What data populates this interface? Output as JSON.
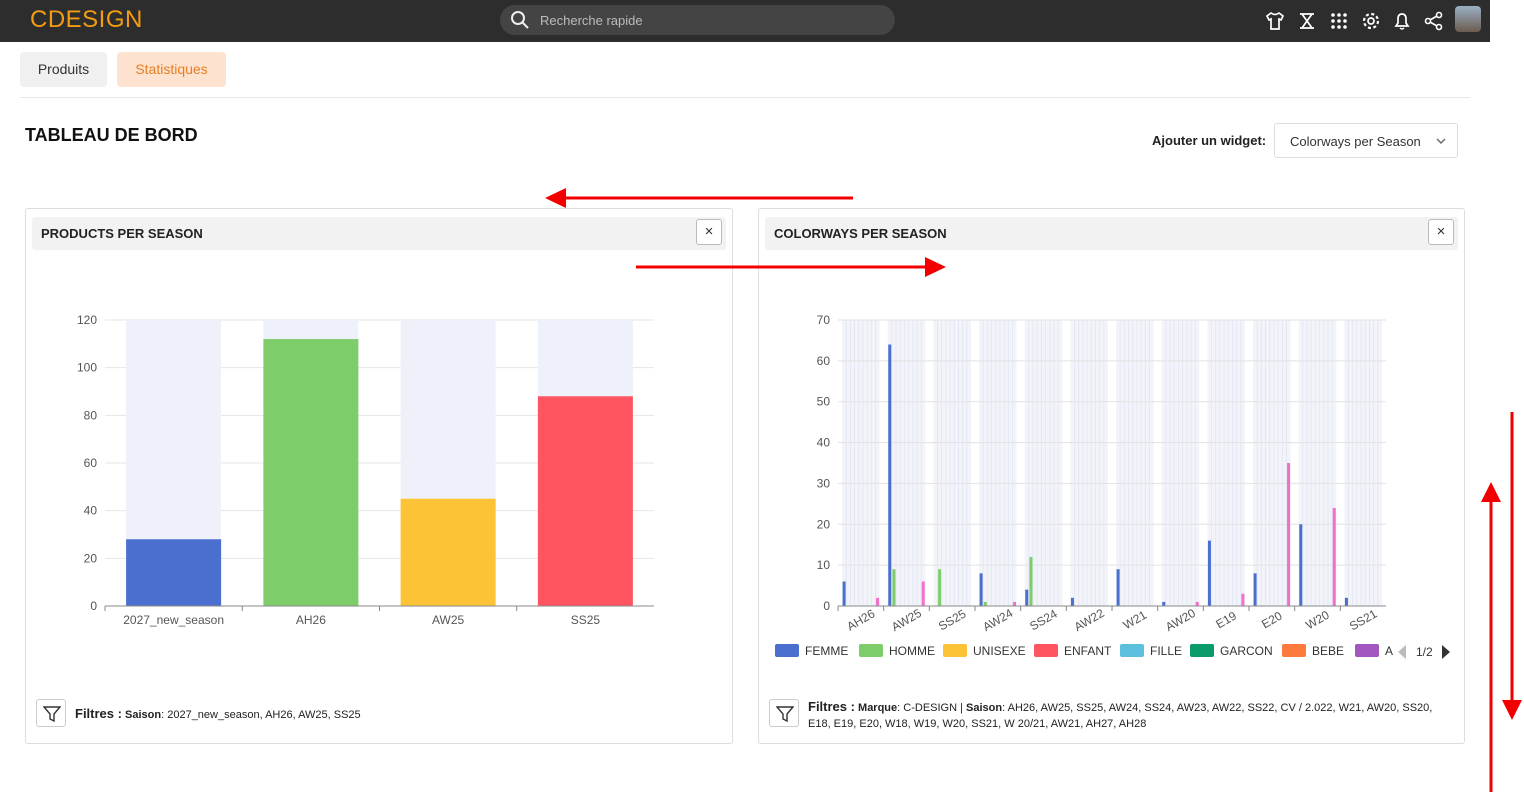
{
  "app": {
    "logo_text": "CDESIGN",
    "search_placeholder": "Recherche rapide",
    "toolbar_icons": [
      "tshirt-icon",
      "collection-icon",
      "apps-grid-icon",
      "gear-icon",
      "bell-icon",
      "share-icon",
      "avatar"
    ]
  },
  "tabs": [
    {
      "label": "Produits",
      "active": false
    },
    {
      "label": "Statistiques",
      "active": true
    }
  ],
  "page": {
    "title": "TABLEAU DE BORD",
    "widget_label": "Ajouter un widget:",
    "widget_select_value": "Colorways per Season"
  },
  "widgets": {
    "products": {
      "title": "PRODUCTS PER SEASON",
      "close_label": "×",
      "filters_lead": "Filtres :",
      "filters_key": "Saison",
      "filters_value": ": 2027_new_season, AH26, AW25, SS25"
    },
    "colorways": {
      "title": "COLORWAYS PER SEASON",
      "close_label": "×",
      "filters_lead": "Filtres :",
      "filters_key1": "Marque",
      "filters_value1": ": C-DESIGN | ",
      "filters_key2": "Saison",
      "filters_value2": ": AH26, AW25, SS25, AW24, SS24, AW23, AW22, SS22, CV / 2.022, W21, AW20, SS20, E18, E19, E20, W18, W19, W20, SS21, W 20/21, AW21, AH27, AH28",
      "legend_page": "1/2"
    }
  },
  "chart_data": [
    {
      "type": "bar",
      "categories": [
        "2027_new_season",
        "AH26",
        "AW25",
        "SS25"
      ],
      "values": [
        28,
        112,
        45,
        88
      ],
      "colors": [
        "#4a6fce",
        "#7ecd6a",
        "#fdc336",
        "#fe5560"
      ],
      "ylim": [
        0,
        120
      ],
      "yticks": [
        0,
        20,
        40,
        60,
        80,
        100,
        120
      ],
      "title": "",
      "xlabel": "",
      "ylabel": "",
      "grid": true
    },
    {
      "type": "bar",
      "categories": [
        "AH26",
        "AW25",
        "SS25",
        "AW24",
        "SS24",
        "AW22",
        "W21",
        "AW20",
        "E19",
        "E20",
        "W20",
        "SS21"
      ],
      "series": [
        {
          "name": "FEMME",
          "color": "#4a6fce",
          "values": [
            6,
            64,
            0,
            8,
            4,
            2,
            9,
            1,
            16,
            8,
            20,
            2
          ]
        },
        {
          "name": "HOMME",
          "color": "#7ecd6a",
          "values": [
            0,
            9,
            9,
            1,
            12,
            0,
            0,
            0,
            0,
            0,
            0,
            0
          ]
        },
        {
          "name": "UNISEXE",
          "color": "#fdc336",
          "values": [
            0,
            0,
            0,
            0,
            0,
            0,
            0,
            0,
            0,
            0,
            0,
            0
          ]
        },
        {
          "name": "ENFANT",
          "color": "#fe5560",
          "values": [
            0,
            0,
            0,
            0,
            0,
            0,
            0,
            0,
            0,
            0,
            0,
            0
          ]
        },
        {
          "name": "FILLE",
          "color": "#5bc0de",
          "values": [
            0,
            0,
            0,
            0,
            0,
            0,
            0,
            0,
            0,
            0,
            0,
            0
          ]
        },
        {
          "name": "GARCON",
          "color": "#0b9a6a",
          "values": [
            0,
            0,
            0,
            0,
            0,
            0,
            0,
            0,
            0,
            0,
            0,
            0
          ]
        },
        {
          "name": "BEBE",
          "color": "#fd7a3e",
          "values": [
            0,
            0,
            0,
            0,
            0,
            0,
            0,
            0,
            0,
            0,
            0,
            0
          ]
        },
        {
          "name": "A",
          "color": "#a257c0",
          "values": [
            0,
            0,
            0,
            0,
            0,
            0,
            0,
            0,
            0,
            0,
            0,
            0
          ]
        },
        {
          "color": "#f36fcb",
          "values": [
            2,
            6,
            0,
            1,
            0,
            0,
            0,
            1,
            3,
            35,
            24,
            0
          ]
        }
      ],
      "ylim": [
        0,
        70
      ],
      "yticks": [
        0,
        10,
        20,
        30,
        40,
        50,
        60,
        70
      ],
      "legend_position": "bottom",
      "title": "",
      "xlabel": "",
      "ylabel": "",
      "grid": true
    }
  ]
}
